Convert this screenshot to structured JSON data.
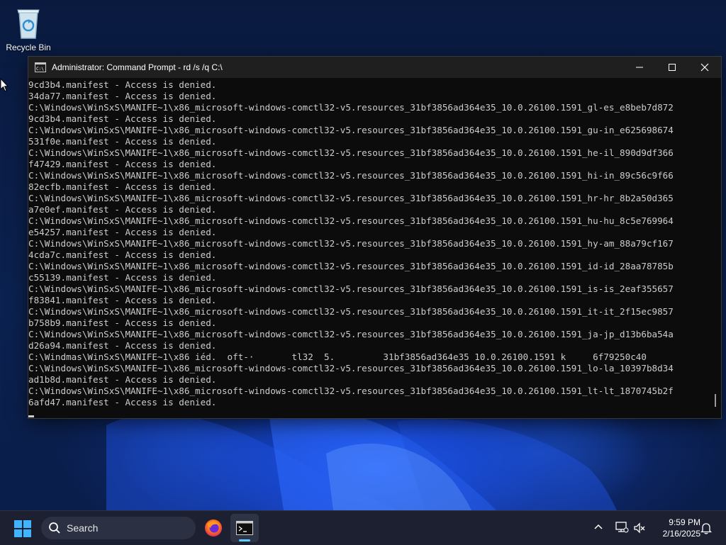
{
  "desktop": {
    "recycle_bin_label": "Recycle Bin"
  },
  "window": {
    "title": "Administrator: Command Prompt - rd  /s /q C:\\",
    "output_lines": [
      "9cd3b4.manifest - Access is denied.",
      "34da77.manifest - Access is denied.",
      "C:\\Windows\\WinSxS\\MANIFE~1\\x86_microsoft-windows-comctl32-v5.resources_31bf3856ad364e35_10.0.26100.1591_gl-es_e8beb7d872",
      "9cd3b4.manifest - Access is denied.",
      "C:\\Windows\\WinSxS\\MANIFE~1\\x86_microsoft-windows-comctl32-v5.resources_31bf3856ad364e35_10.0.26100.1591_gu-in_e625698674",
      "531f0e.manifest - Access is denied.",
      "C:\\Windows\\WinSxS\\MANIFE~1\\x86_microsoft-windows-comctl32-v5.resources_31bf3856ad364e35_10.0.26100.1591_he-il_890d9df366",
      "f47429.manifest - Access is denied.",
      "C:\\Windows\\WinSxS\\MANIFE~1\\x86_microsoft-windows-comctl32-v5.resources_31bf3856ad364e35_10.0.26100.1591_hi-in_89c56c9f66",
      "82ecfb.manifest - Access is denied.",
      "C:\\Windows\\WinSxS\\MANIFE~1\\x86_microsoft-windows-comctl32-v5.resources_31bf3856ad364e35_10.0.26100.1591_hr-hr_8b2a50d365",
      "a7e0ef.manifest - Access is denied.",
      "C:\\Windows\\WinSxS\\MANIFE~1\\x86_microsoft-windows-comctl32-v5.resources_31bf3856ad364e35_10.0.26100.1591_hu-hu_8c5e769964",
      "e54257.manifest - Access is denied.",
      "C:\\Windows\\WinSxS\\MANIFE~1\\x86_microsoft-windows-comctl32-v5.resources_31bf3856ad364e35_10.0.26100.1591_hy-am_88a79cf167",
      "4cda7c.manifest - Access is denied.",
      "C:\\Windows\\WinSxS\\MANIFE~1\\x86_microsoft-windows-comctl32-v5.resources_31bf3856ad364e35_10.0.26100.1591_id-id_28aa78785b",
      "c55139.manifest - Access is denied.",
      "C:\\Windows\\WinSxS\\MANIFE~1\\x86_microsoft-windows-comctl32-v5.resources_31bf3856ad364e35_10.0.26100.1591_is-is_2eaf355657",
      "f83841.manifest - Access is denied.",
      "C:\\Windows\\WinSxS\\MANIFE~1\\x86_microsoft-windows-comctl32-v5.resources_31bf3856ad364e35_10.0.26100.1591_it-it_2f15ec9857",
      "b758b9.manifest - Access is denied.",
      "C:\\Windows\\WinSxS\\MANIFE~1\\x86_microsoft-windows-comctl32-v5.resources_31bf3856ad364e35_10.0.26100.1591_ja-jp_d13b6ba54a",
      "d26a94.manifest - Access is denied.",
      "C:\\Windmas\\WinSxS\\MANIFE~1\\x86 iéd.  oft-·       tl32  5.         31bf3856ad364e35 10.0.26100.1591 k     6f79250c40",
      "C:\\Windows\\WinSxS\\MANIFE~1\\x86_microsoft-windows-comctl32-v5.resources_31bf3856ad364e35_10.0.26100.1591_lo-la_10397b8d34",
      "ad1b8d.manifest - Access is denied.",
      "C:\\Windows\\WinSxS\\MANIFE~1\\x86_microsoft-windows-comctl32-v5.resources_31bf3856ad364e35_10.0.26100.1591_lt-lt_1870745b2f",
      "6afd47.manifest - Access is denied."
    ]
  },
  "taskbar": {
    "search_placeholder": "Search",
    "time": "9:59 PM",
    "date": "2/16/2025"
  },
  "colors": {
    "console_bg": "#0c0c0c",
    "console_text": "#cccccc",
    "titlebar_bg": "#1f1f1f",
    "taskbar_bg": "#1c2030",
    "accent": "#60cdff"
  }
}
